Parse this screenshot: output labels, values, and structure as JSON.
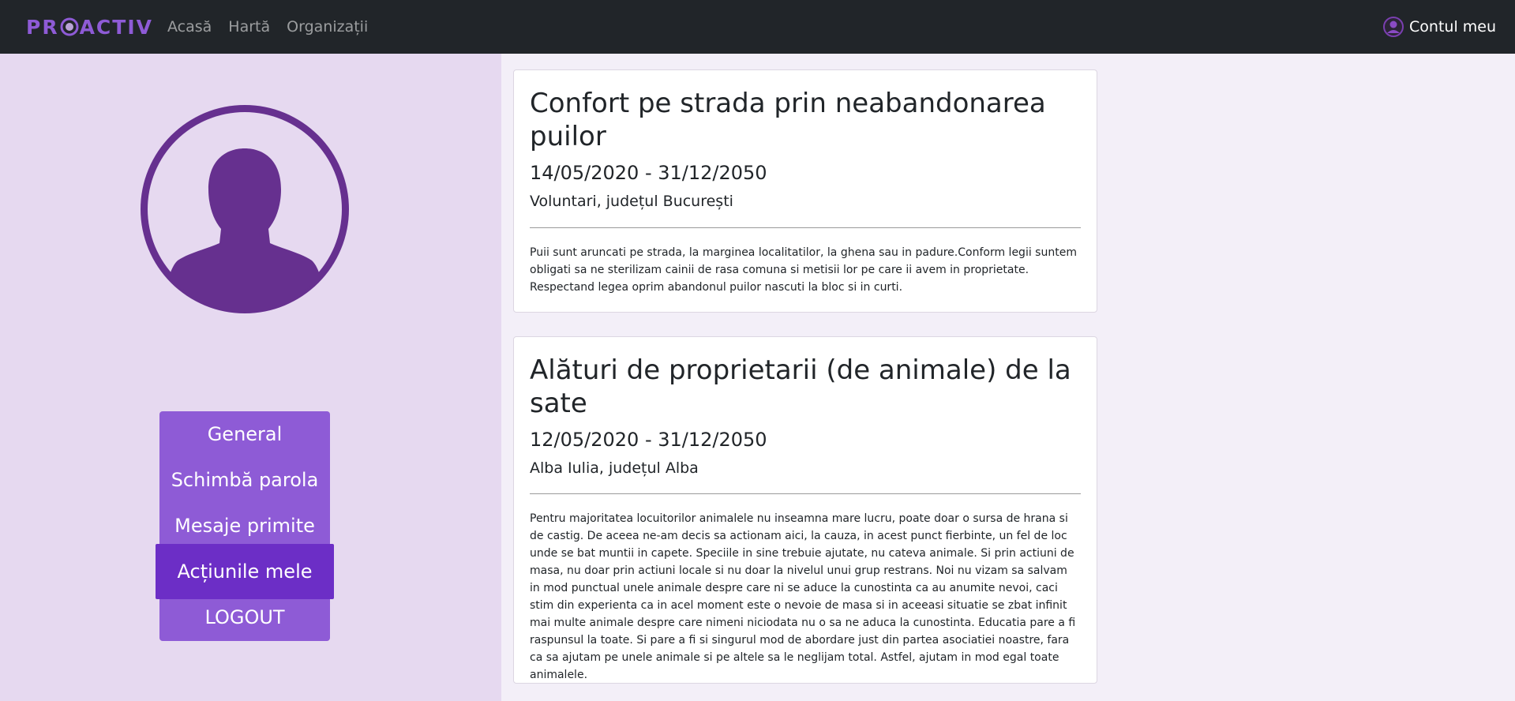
{
  "navbar": {
    "logo": {
      "left": "PR",
      "right": "ACTIV"
    },
    "links": [
      "Acasă",
      "Hartă",
      "Organizații"
    ],
    "account_label": "Contul meu"
  },
  "sidebar": {
    "menu": [
      "General",
      "Schimbă parola",
      "Mesaje primite",
      "Acțiunile mele",
      "LOGOUT"
    ],
    "active_item": "Acțiunile mele"
  },
  "actions": [
    {
      "title": "Confort pe strada prin neabandonarea puilor",
      "dates": "14/05/2020 - 31/12/2050",
      "location": "Voluntari, județul București",
      "description": "Puii sunt aruncati pe strada, la marginea localitatilor, la ghena sau in padure.Conform legii suntem obligati sa ne sterilizam cainii de rasa comuna si metisii lor pe care ii avem in proprietate. Respectand legea oprim abandonul puilor nascuti la bloc si in curti."
    },
    {
      "title": "Alături de proprietarii (de animale) de la sate",
      "dates": "12/05/2020 - 31/12/2050",
      "location": "Alba Iulia, județul Alba",
      "description": "Pentru majoritatea locuitorilor animalele nu inseamna mare lucru, poate doar o sursa de hrana si de castig. De aceea ne-am decis sa actionam aici, la cauza, in acest punct fierbinte, un fel de loc unde se bat muntii in capete. Speciile in sine trebuie ajutate, nu cateva animale. Si prin actiuni de masa, nu doar prin actiuni locale si nu doar la nivelul unui grup restrans. Noi nu vizam sa salvam in mod punctual unele animale despre care ni se aduce la cunostinta ca au anumite nevoi, caci stim din experienta ca in acel moment este o nevoie de masa si in aceeasi situatie se zbat infinit mai multe animale despre care nimeni niciodata nu o sa ne aduca la cunostinta. Educatia pare a fi raspunsul la toate. Si pare a fi si singurul mod de abordare just din partea asociatiei noastre, fara ca sa ajutam pe unele animale si pe altele sa le neglijam total. Astfel, ajutam in mod egal toate animalele."
    }
  ],
  "colors": {
    "navbar_bg": "#212529",
    "brand_purple": "#8e5bd6",
    "active_purple": "#6c2ec6",
    "avatar_purple": "#66308f",
    "sidebar_bg": "#e6d9f0",
    "page_bg": "#f3eff8"
  },
  "icons": [
    "proactiv-logo",
    "user-silhouette-icon",
    "account-icon"
  ]
}
